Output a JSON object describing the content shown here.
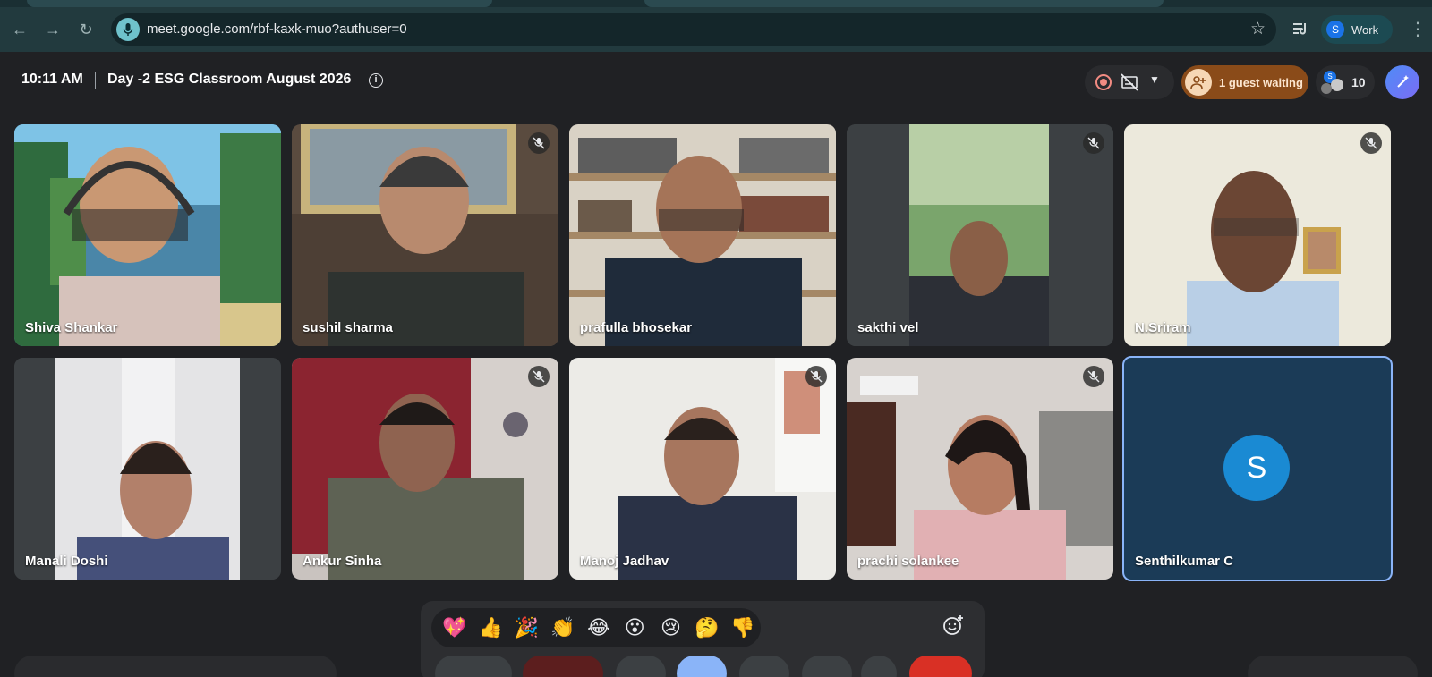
{
  "browser": {
    "url": "meet.google.com/rbf-kaxk-muo?authuser=0",
    "profile": {
      "initial": "S",
      "label": "Work"
    }
  },
  "meeting": {
    "time": "10:11 AM",
    "title": "Day -2 ESG Classroom August 2026",
    "info_glyph": "i",
    "guest_waiting": "1 guest waiting",
    "participant_count": "10",
    "people_initial": "S"
  },
  "participants": [
    {
      "name": "Shiva Shankar",
      "muted": false
    },
    {
      "name": "sushil sharma",
      "muted": true
    },
    {
      "name": "prafulla bhosekar",
      "muted": false
    },
    {
      "name": "sakthi vel",
      "muted": true
    },
    {
      "name": "N.Sriram",
      "muted": true
    },
    {
      "name": "Manali Doshi",
      "muted": false
    },
    {
      "name": "Ankur Sinha",
      "muted": true
    },
    {
      "name": "Manoj Jadhav",
      "muted": true
    },
    {
      "name": "prachi solankee",
      "muted": true
    },
    {
      "name": "Senthilkumar C",
      "muted": false,
      "avatar_initial": "S"
    }
  ],
  "reactions": [
    "💖",
    "👍",
    "🎉",
    "👏",
    "😂",
    "😮",
    "😢",
    "🤔",
    "👎"
  ],
  "colors": {
    "background": "#202124",
    "accent": "#8ab4f8",
    "guest_pill": "#8a4b19",
    "avatar": "#1a8ad3"
  }
}
